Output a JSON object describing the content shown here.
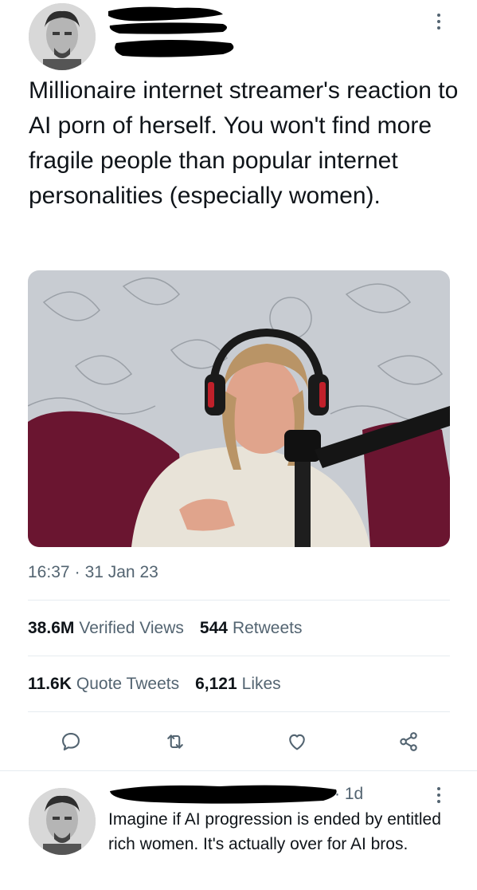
{
  "tweet": {
    "text": "Millionaire internet streamer's reaction to AI porn of herself. You won't find more fragile people than popular internet personalities (especially women).",
    "time": "16:37",
    "separator": "·",
    "date": "31 Jan 23"
  },
  "stats": {
    "views_count": "38.6M",
    "views_label": "Verified Views",
    "retweets_count": "544",
    "retweets_label": "Retweets",
    "quotes_count": "11.6K",
    "quotes_label": "Quote Tweets",
    "likes_count": "6,121",
    "likes_label": "Likes"
  },
  "actions": {
    "reply_icon": "reply-icon",
    "retweet_icon": "retweet-icon",
    "like_icon": "heart-icon",
    "share_icon": "share-icon"
  },
  "reply": {
    "meta": "· 1d",
    "text": "Imagine if AI progression is ended by entitled rich women. It's actually over for AI bros."
  },
  "colors": {
    "text": "#0f1419",
    "secondary": "#536471",
    "divider": "#e6ecf0"
  }
}
